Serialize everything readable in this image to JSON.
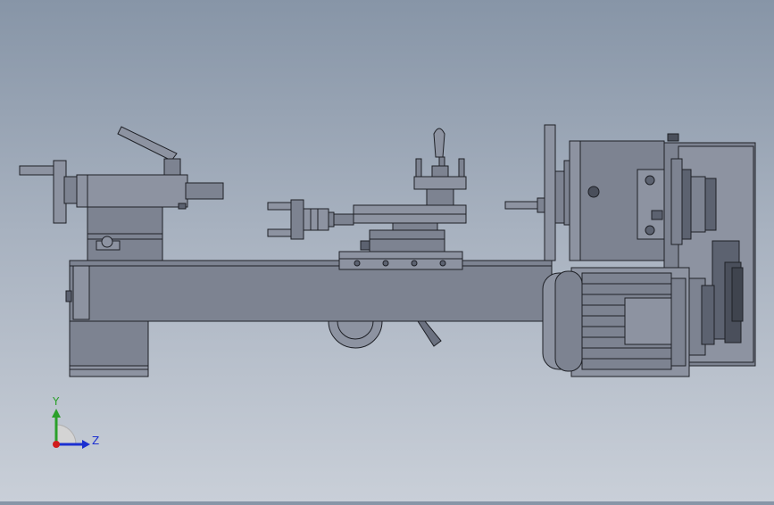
{
  "viewport": {
    "model": "lathe-assembly",
    "view": "front"
  },
  "triad": {
    "y_label": "Y",
    "z_label": "Z",
    "y_color": "#2aa02a",
    "z_color": "#1b2fd0",
    "x_color": "#d01b1b"
  },
  "colors": {
    "part_fill": "#7d8391",
    "part_light": "#8d93a1",
    "part_dark": "#5c6270",
    "edge": "#1e2026"
  }
}
